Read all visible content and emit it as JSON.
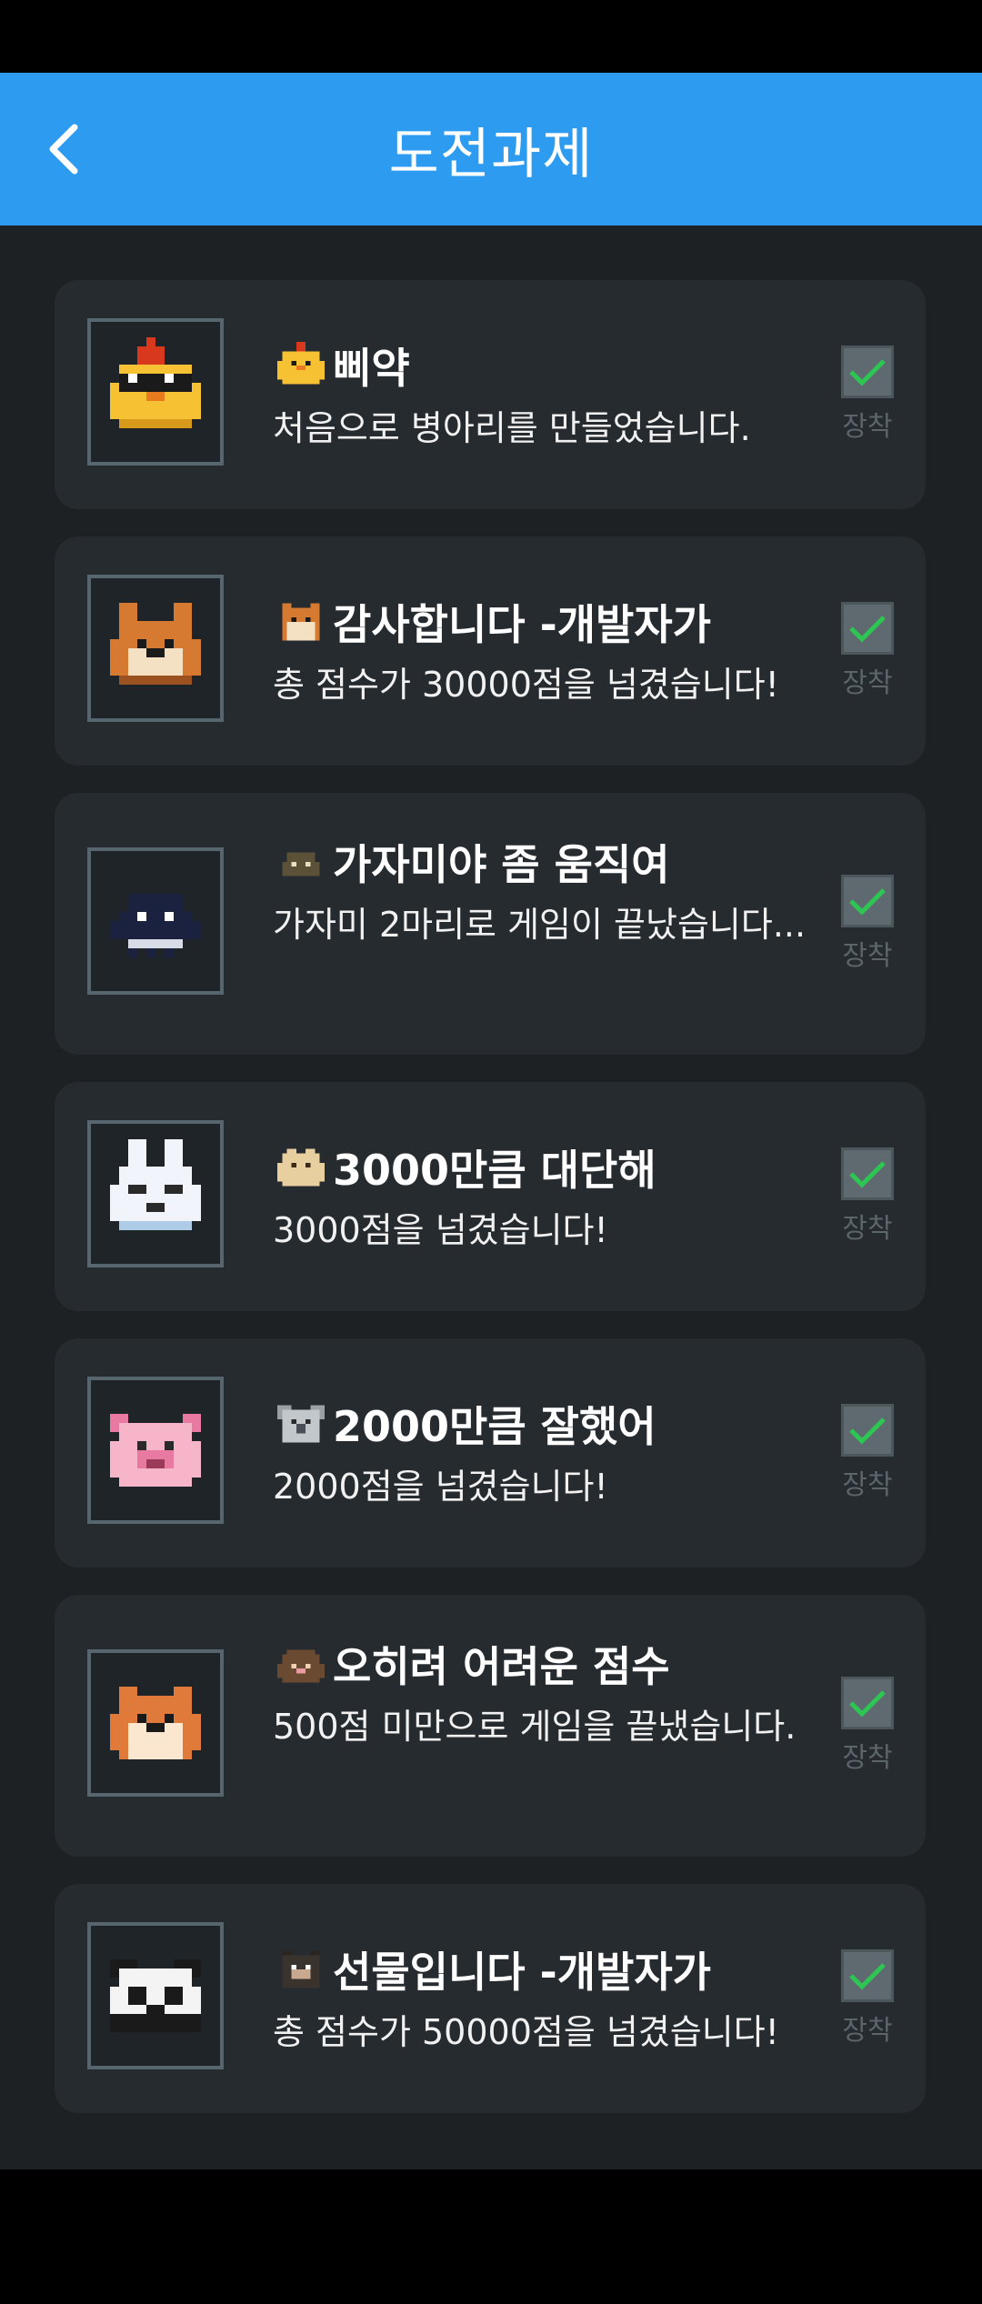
{
  "header": {
    "title": "도전과제"
  },
  "equip_label": "장착",
  "achievements": [
    {
      "title": "삐약",
      "description": "처음으로 병아리를 만들었습니다.",
      "icon": "chick-icon",
      "equipped": true
    },
    {
      "title": "감사합니다 -개발자가",
      "description": "총 점수가 30000점을 넘겼습니다!",
      "icon": "shiba-dog-icon",
      "equipped": true
    },
    {
      "title": "가자미야 좀 움직여",
      "description": "가자미 2마리로 게임이 끝났습니다...",
      "icon": "flatfish-icon",
      "equipped": true
    },
    {
      "title": "3000만큼 대단해",
      "description": "3000점을 넘겼습니다!",
      "icon": "rabbit-icon",
      "equipped": true
    },
    {
      "title": "2000만큼 잘했어",
      "description": "2000점을 넘겼습니다!",
      "icon": "pig-icon",
      "equipped": true
    },
    {
      "title": "오히려 어려운 점수",
      "description": "500점 미만으로 게임을 끝냈습니다.",
      "icon": "hamster-icon",
      "equipped": true
    },
    {
      "title": "선물입니다 -개발자가",
      "description": "총 점수가 50000점을 넘겼습니다!",
      "icon": "panda-icon",
      "equipped": true
    }
  ]
}
